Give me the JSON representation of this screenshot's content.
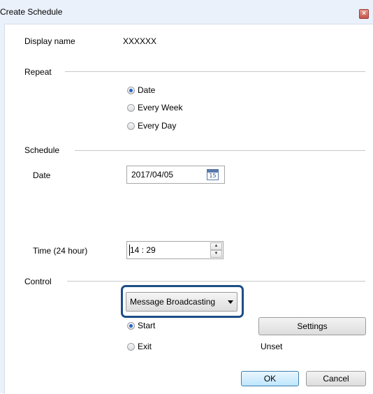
{
  "window": {
    "title": "Create Schedule",
    "close_glyph": "×"
  },
  "display_name": {
    "label": "Display name",
    "value": "XXXXXX"
  },
  "repeat": {
    "label": "Repeat",
    "options": [
      {
        "label": "Date",
        "selected": true
      },
      {
        "label": "Every Week",
        "selected": false
      },
      {
        "label": "Every Day",
        "selected": false
      }
    ]
  },
  "schedule": {
    "label": "Schedule",
    "date_label": "Date",
    "date_value": "2017/04/05",
    "calendar_day": "15",
    "time_label": "Time (24 hour)",
    "time_value": "14 : 29"
  },
  "control": {
    "label": "Control",
    "dropdown_value": "Message Broadcasting",
    "options": [
      {
        "label": "Start",
        "selected": true
      },
      {
        "label": "Exit",
        "selected": false
      }
    ],
    "settings_label": "Settings",
    "status_text": "Unset"
  },
  "footer": {
    "ok_label": "OK",
    "cancel_label": "Cancel"
  },
  "colors": {
    "highlight_border": "#1d4e86",
    "radio_selected": "#2a63c6",
    "window_bg": "#eaf1fb"
  }
}
